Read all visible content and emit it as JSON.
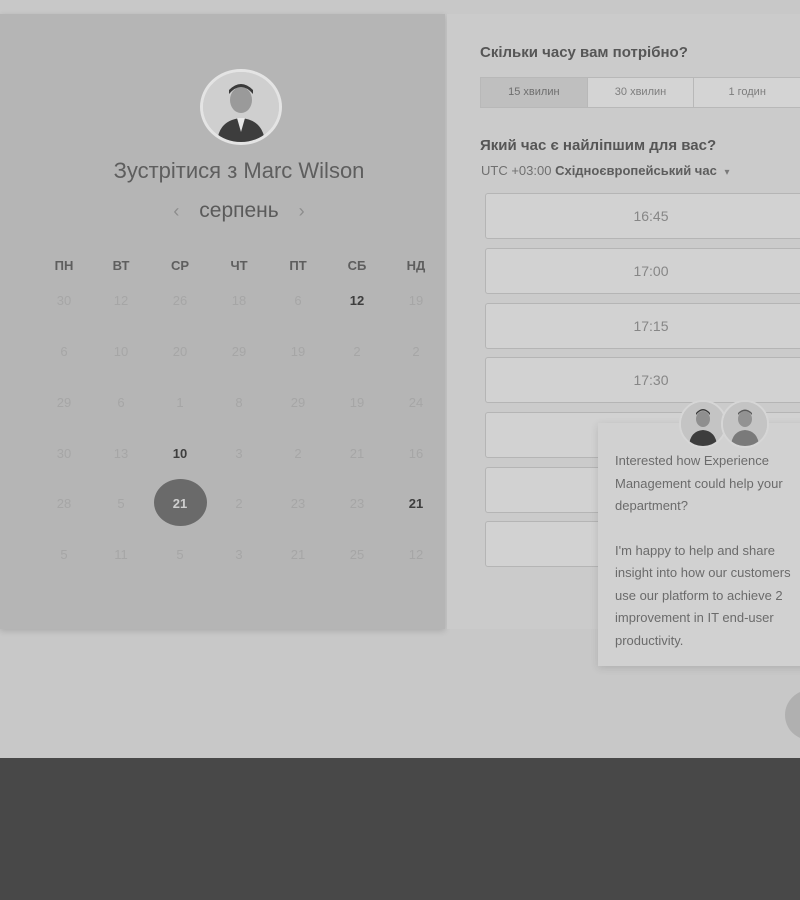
{
  "host": {
    "title_prefix": "Зустрітися з",
    "name": "Marc Wilson"
  },
  "calendar": {
    "month": "серпень",
    "prev_arrow": "‹",
    "next_arrow": "›",
    "weekdays": [
      "ПН",
      "ВТ",
      "СР",
      "ЧТ",
      "ПТ",
      "СБ",
      "НД"
    ],
    "rows": [
      [
        "30",
        "12",
        "26",
        "18",
        "6",
        "12",
        "19"
      ],
      [
        "6",
        "10",
        "20",
        "29",
        "19",
        "2",
        "2"
      ],
      [
        "29",
        "6",
        "1",
        "8",
        "29",
        "19",
        "24"
      ],
      [
        "30",
        "13",
        "10",
        "3",
        "2",
        "21",
        "16"
      ],
      [
        "28",
        "5",
        "21",
        "2",
        "23",
        "23",
        "21"
      ],
      [
        "5",
        "11",
        "5",
        "3",
        "21",
        "25",
        "12"
      ]
    ],
    "available": [
      "0-5",
      "3-2",
      "4-6"
    ],
    "selected": "4-2"
  },
  "booking": {
    "duration_question": "Скільки часу вам потрібно?",
    "durations": [
      "15 хвилин",
      "30 хвилин",
      "1 годин"
    ],
    "active_duration": 0,
    "time_question": "Який час є найліпшим для вас?",
    "timezone_offset": "UTC +03:00",
    "timezone_name": "Східноєвропейський час",
    "caret": "▾",
    "slots": [
      "16:45",
      "17:00",
      "17:15",
      "17:30",
      "",
      "",
      ""
    ]
  },
  "chat": {
    "message_1": "Interested how Experience Management could help your department?",
    "message_2": "I'm happy to help and share insight into how our customers use our platform to achieve 2 improvement in IT end-user productivity."
  },
  "colors": {
    "overlay_bg": "#c8c8c8",
    "panel_left": "#b5b5b5",
    "panel_right": "#cbcbcb",
    "footer": "#484848",
    "selected_day": "#6a6a6a"
  }
}
